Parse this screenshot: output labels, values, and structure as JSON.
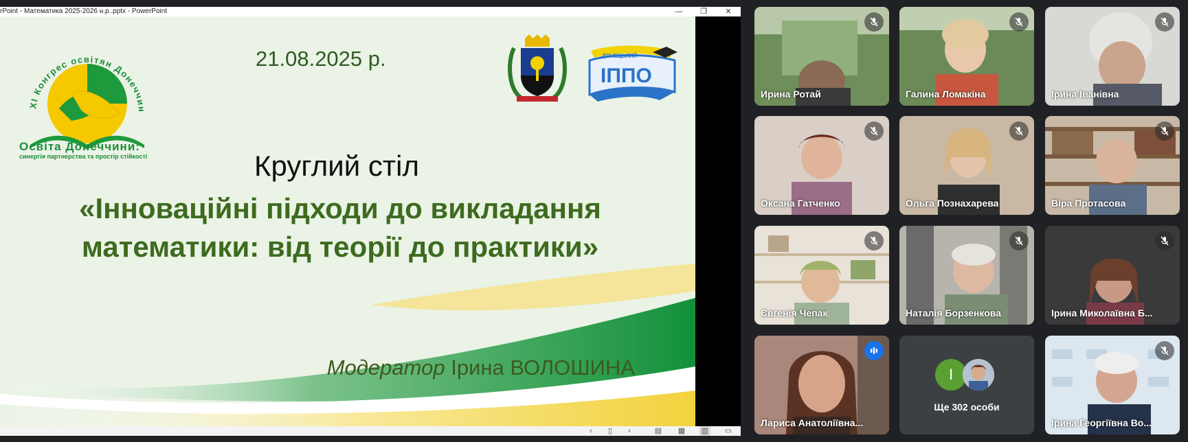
{
  "powerpoint": {
    "title_bar": "rPoint  -  Математика 2025-2026 н.р..pptx - PowerPoint",
    "window_buttons": {
      "minimize": "—",
      "restore": "❐",
      "close": "✕"
    },
    "slide": {
      "date": "21.08.2025 р.",
      "heading": "Круглий стіл",
      "title_line1": "«Інноваційні підходи до викладання",
      "title_line2": "математики: від теорії до практики»",
      "moderator_label": "Модератор",
      "moderator_name": "Ірина ВОЛОШИНА",
      "logo_arc_text": "ХІ Конгрес освітян Донеччини",
      "logo_caption_line1": "Освіта Донеччини:",
      "logo_caption_line2": "синергія партнерства та простір стійкості",
      "ippo_top_text": "ДОНЕЦЬКИЙ",
      "ippo_text": "ІППО"
    },
    "status_bar_icons": [
      "chevron-left",
      "notes",
      "chevron-right",
      "normal-view",
      "slide-sorter-view",
      "reading-view",
      "presenter-view"
    ]
  },
  "meeting": {
    "tiles": [
      {
        "name": "Ирина Ротай",
        "mic": "muted"
      },
      {
        "name": "Галина Ломакіна",
        "mic": "muted"
      },
      {
        "name": "Ірина Іванівна",
        "mic": "muted"
      },
      {
        "name": "Оксана Гатченко",
        "mic": "muted"
      },
      {
        "name": "Ольга Познахарева",
        "mic": "muted"
      },
      {
        "name": "Віра Протасова",
        "mic": "muted"
      },
      {
        "name": "Євгенія Чепак",
        "mic": "muted"
      },
      {
        "name": "Наталія Борзенкова",
        "mic": "muted"
      },
      {
        "name": "Ірина Миколаївна Б...",
        "mic": "muted"
      },
      {
        "name": "Лариса Анатоліївна...",
        "mic": "speaking"
      },
      {
        "name": "Ірина Георгіївна Во...",
        "mic": "muted"
      }
    ],
    "more": {
      "avatar_letter": "І",
      "label": "Ще 302 особи"
    }
  }
}
